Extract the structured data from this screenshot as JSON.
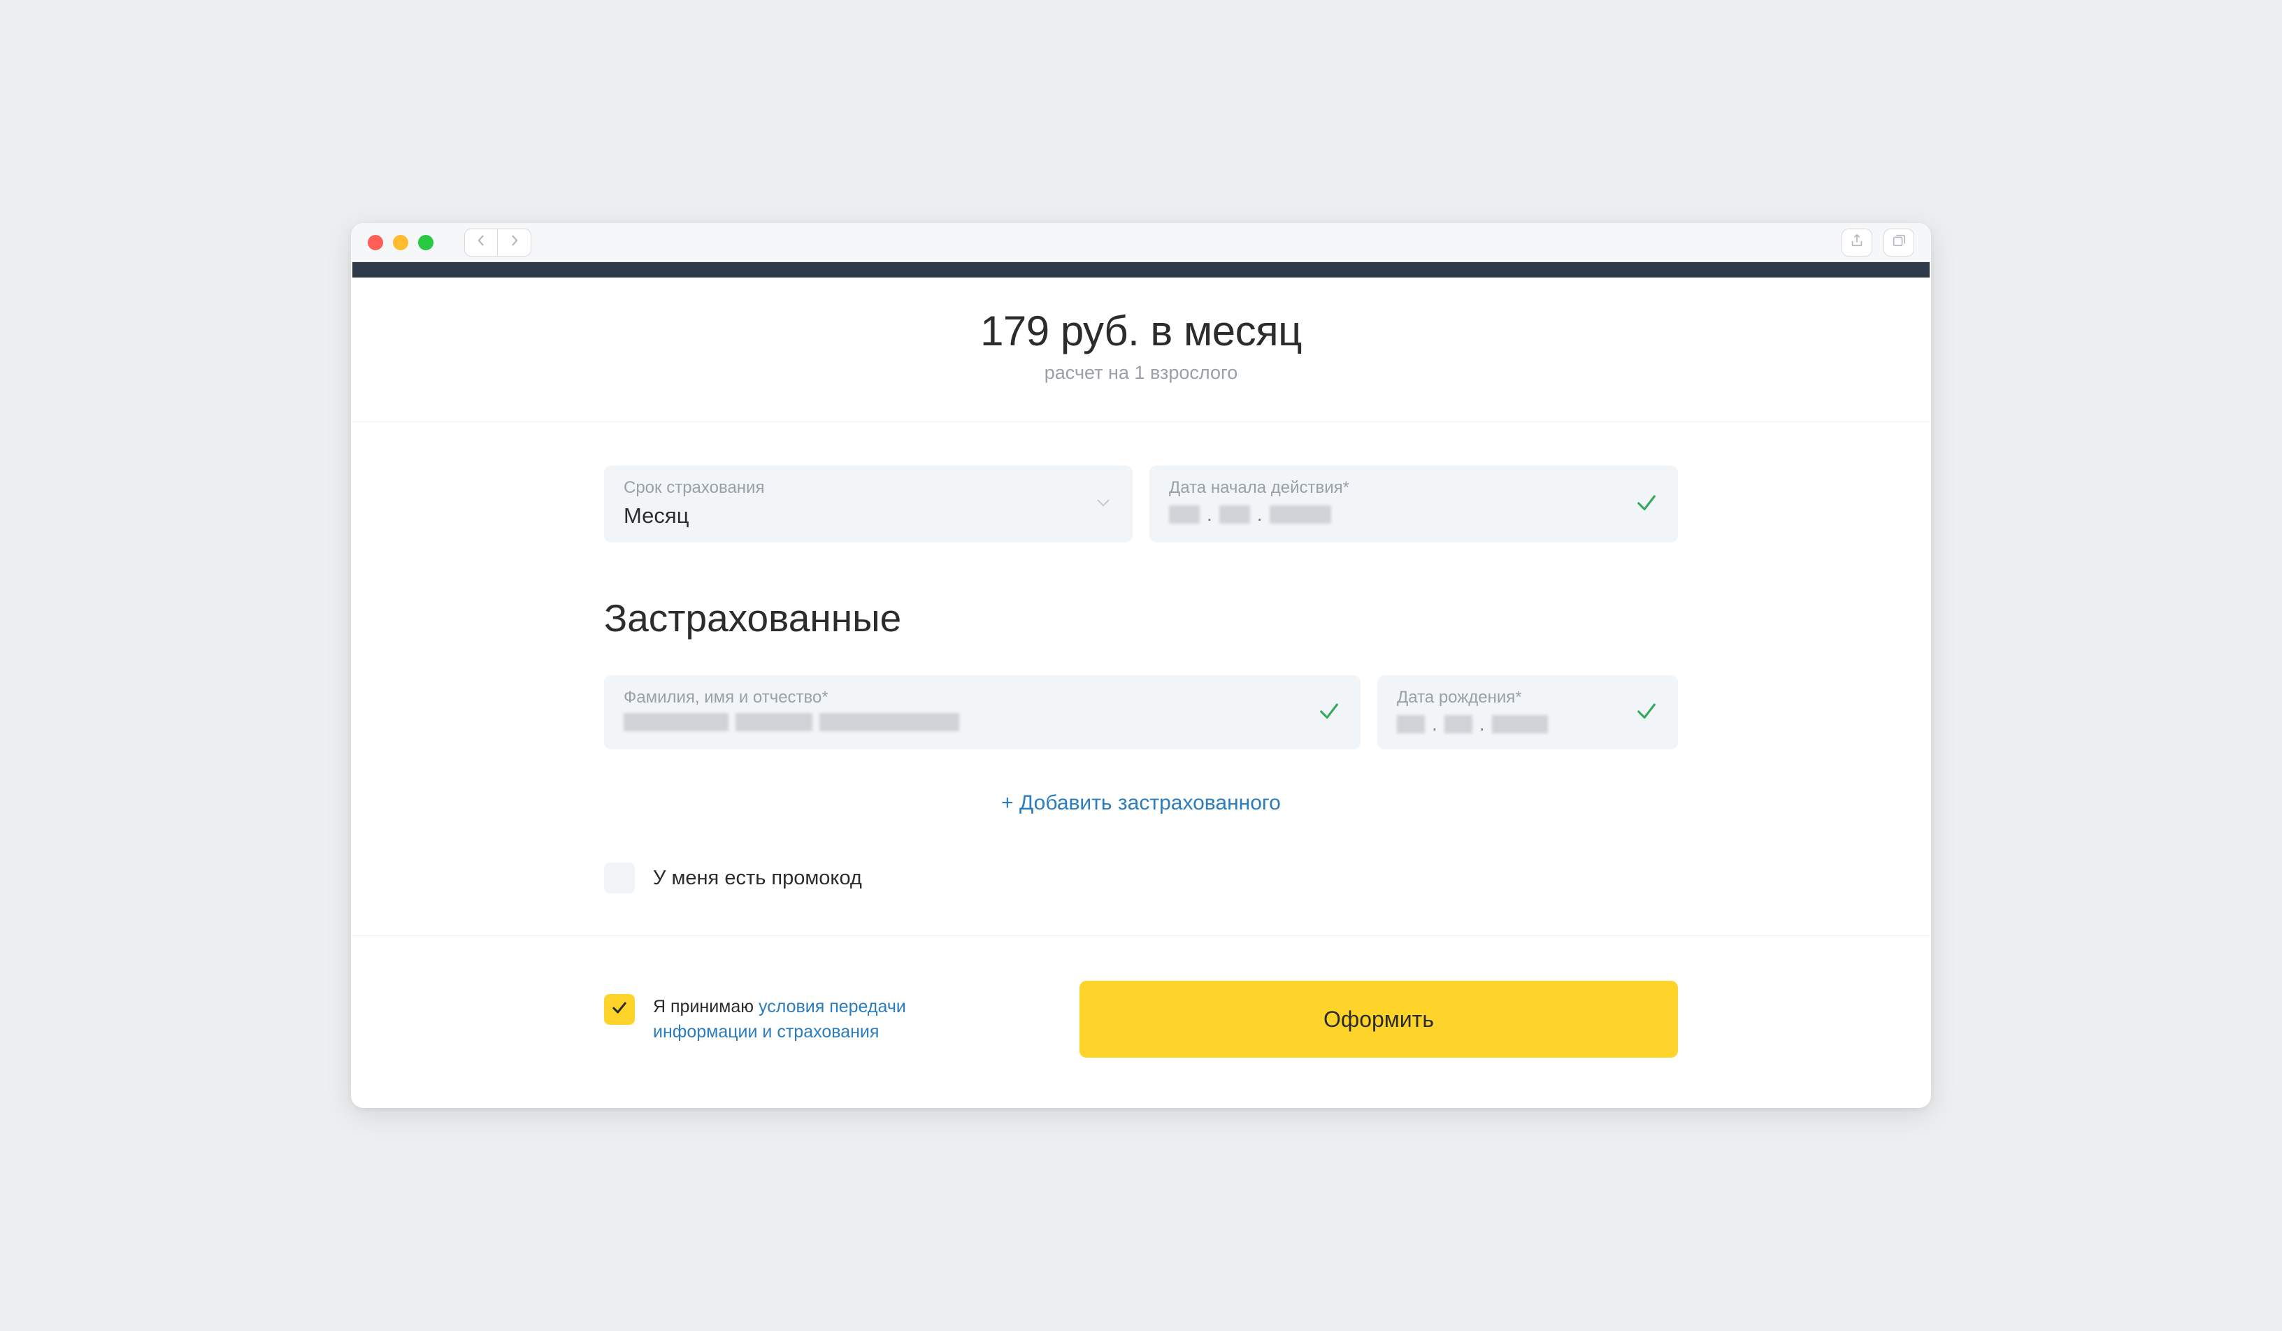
{
  "browser": {
    "back": "back",
    "forward": "forward",
    "share": "share",
    "tabs": "tabs"
  },
  "price": {
    "title": "179 руб. в месяц",
    "subtitle": "расчет на 1 взрослого"
  },
  "fields": {
    "duration_label": "Срок страхования",
    "duration_value": "Месяц",
    "start_label": "Дата начала действия*"
  },
  "insured": {
    "heading": "Застрахованные",
    "name_label": "Фамилия, имя и отчество*",
    "dob_label": "Дата рождения*",
    "add_link": "+ Добавить застрахованного"
  },
  "promo": {
    "label": "У меня есть промокод"
  },
  "terms": {
    "prefix": "Я принимаю",
    "link": "условия передачи информации и страхования"
  },
  "submit": {
    "label": "Оформить"
  }
}
